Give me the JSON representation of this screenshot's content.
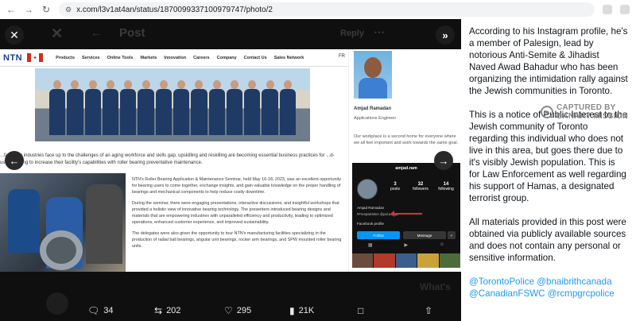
{
  "browser": {
    "url": "x.com/l3v1at4an/status/1870099337100979747/photo/2"
  },
  "underlay": {
    "header_title": "Post",
    "reply_label": "Reply",
    "whats": "What's"
  },
  "ntn": {
    "logo": "NTN",
    "menu": [
      "Products",
      "Services",
      "Online Tools",
      "Markets",
      "Innovation",
      "Careers",
      "Company",
      "Contact Us",
      "Sales Network"
    ],
    "lang": "FR",
    "mid_text": "...facturing industries face up to the challenges of an aging workforce and skills gap, upskilling and reskilling are becoming essential business practices for ...d-users looking to increase their facility's capabilities with roller bearing preventative maintenance.",
    "para1": "NTN's Roller Bearing Application & Maintenance Seminar, held May 16-18, 2023, was an excellent opportunity for bearing users to come together, exchange insights, and gain valuable knowledge on the proper handling of bearings and mechanical components to help reduce costly downtime.",
    "para2": "During the seminar, there were engaging presentations, interactive discussions, and insightful workshops that provided a holistic view of innovative bearing technology. The presenters introduced bearing designs and materials that are empowering industries with unparalleled efficiency and productivity, leading to optimized operations, enhanced customer experience, and improved sustainability.",
    "para3": "The delegates were also given the opportunity to tour NTN's manufacturing facilities specializing in the production of radial ball bearings, angular unit bearings, rocker arm bearings, and SPW mounted roller bearing units.",
    "profile_name": "Amjad Ramadan",
    "profile_role": "Applications Engineer",
    "workplace_text": "Our workplace is a second home for everyone where we all feel important and work towards the same goal."
  },
  "instagram": {
    "handle": "amjad.ram",
    "posts_count": "3",
    "posts_label": "posts",
    "followers_count": "32",
    "followers_label": "followers",
    "following_count": "14",
    "following_label": "following",
    "name_line": "Amjad Ramadan",
    "tag_line": "#Freepalestine @pal.assign",
    "fb_label": "Facebook profile",
    "follow_label": "Follow",
    "message_label": "Message"
  },
  "stats": {
    "replies": "34",
    "reposts": "202",
    "likes": "295",
    "views": "21K"
  },
  "watermark": {
    "line1": "CAPTURED BY",
    "line2": "CANARY MISSION"
  },
  "right_panel": {
    "para1": "According to his Instagram profile, he's a member of Palesign, lead by notorious Anti-Semite & Jihadist Naved Awad Bahadur who has been organizing the intimidation rally against the Jewish communities in Toronto.",
    "para2": "This is a notice of Public Interest to the Jewish community of Toronto regarding this individual who does not live in this area, but goes there due to it's visibly Jewish population. This is for Law Enforcement as well regarding his support of Hamas, a designated terrorist group.",
    "para3": "All materials provided in this post were obtained via publicly available sources and does not contain any personal or sensitive information.",
    "mentions": "@TorontoPolice @bnaibrithcanada @CanadianFSWC @rcmpgrcpolice"
  },
  "colors": {
    "link": "#1d9bf0",
    "ntn_blue": "#1b3f8f",
    "canada_red": "#d52b1e"
  }
}
